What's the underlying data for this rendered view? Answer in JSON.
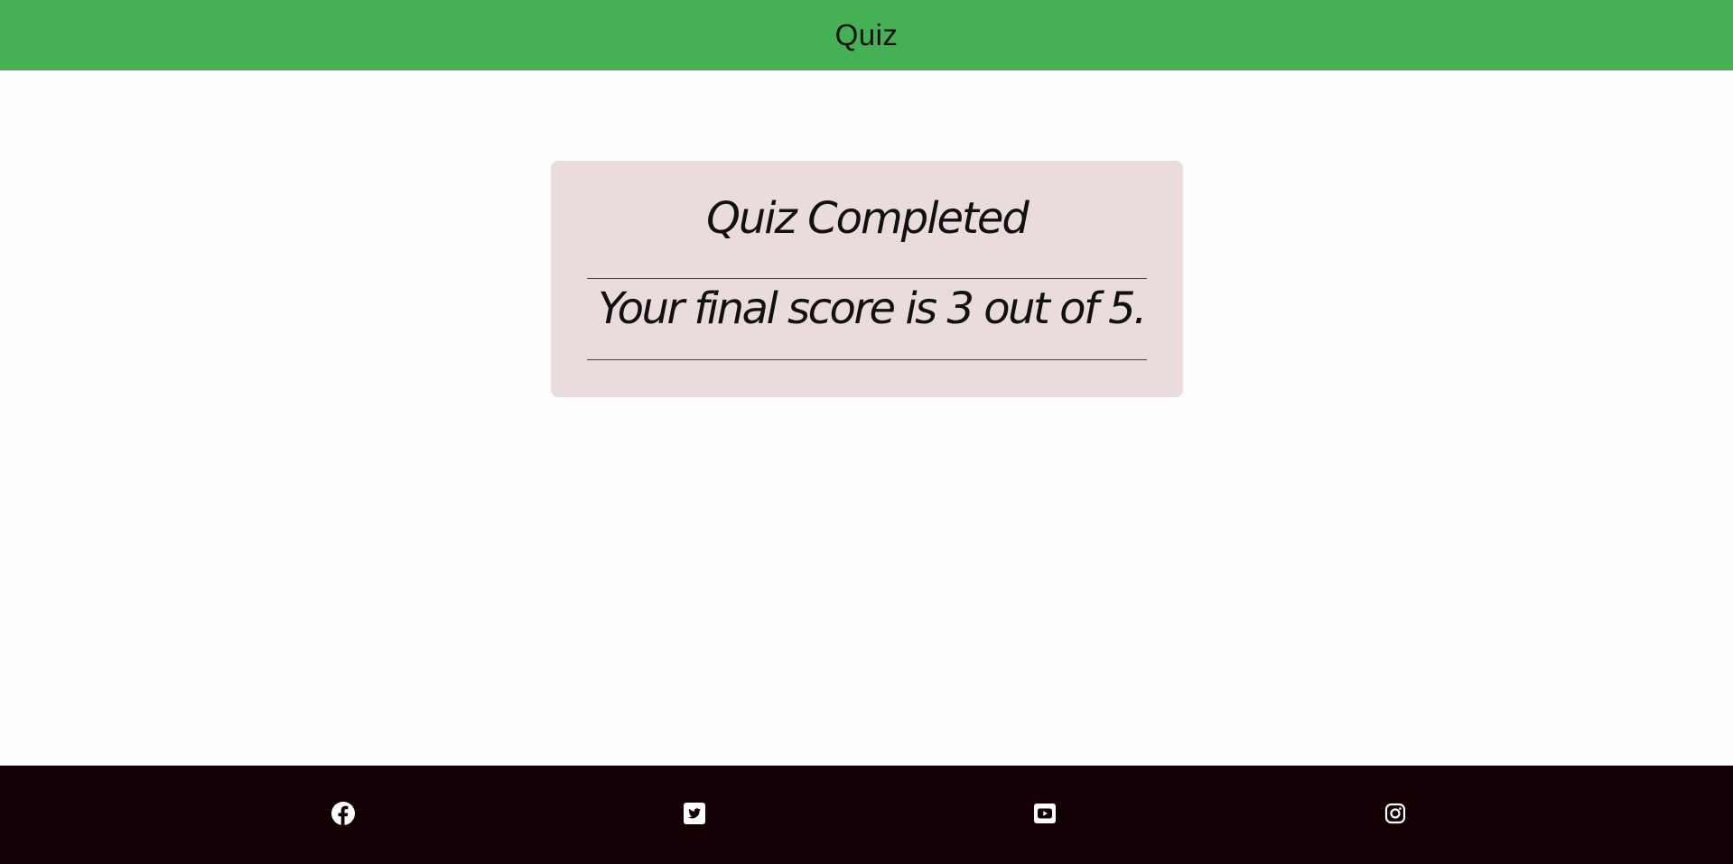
{
  "header": {
    "title": "Quiz"
  },
  "result": {
    "heading": "Quiz Completed",
    "score_text": "Your final score is 3 out of 5."
  },
  "footer": {
    "social": [
      {
        "icon": "facebook-icon"
      },
      {
        "icon": "twitter-icon"
      },
      {
        "icon": "youtube-icon"
      },
      {
        "icon": "instagram-icon"
      }
    ]
  },
  "colors": {
    "header_bg": "#45b054",
    "card_bg": "#eadcdc",
    "footer_bg": "#130004",
    "page_bg": "#fefdfd"
  }
}
